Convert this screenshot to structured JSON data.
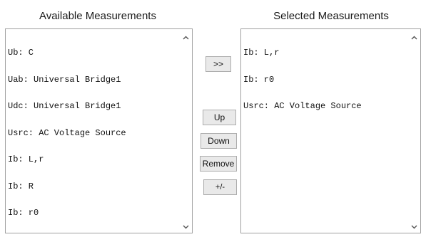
{
  "available": {
    "title": "Available Measurements",
    "items": [
      "Ub: C",
      "Uab: Universal Bridge1",
      "Udc: Universal Bridge1",
      "Usrc: AC Voltage Source",
      "Ib: L,r",
      "Ib: R",
      "Ib: r0"
    ]
  },
  "selected": {
    "title": "Selected Measurements",
    "items": [
      "Ib: L,r",
      "Ib: r0",
      "Usrc: AC Voltage Source"
    ]
  },
  "buttons": {
    "add": ">>",
    "up": "Up",
    "down": "Down",
    "remove": "Remove",
    "plus_minus": "+/-"
  },
  "icons": {
    "scroll_up": "chevron-up-icon",
    "scroll_down": "chevron-down-icon"
  }
}
